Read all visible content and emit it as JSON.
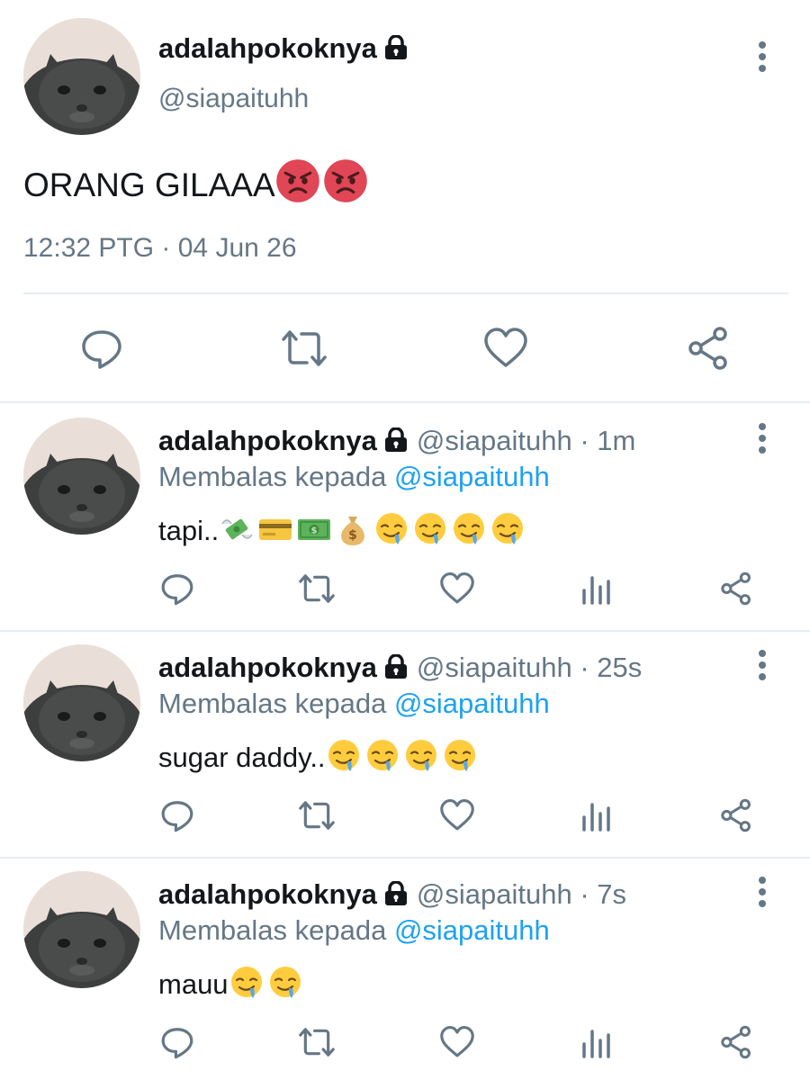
{
  "main_tweet": {
    "display_name": "adalahpokoknya",
    "handle": "@siapaituhh",
    "text": "ORANG GILAAA",
    "text_emojis": [
      "angry-face",
      "angry-face"
    ],
    "timestamp": "12:32 PTG · 04 Jun 26",
    "actions": [
      "reply",
      "retweet",
      "like",
      "share"
    ]
  },
  "replies": [
    {
      "display_name": "adalahpokoknya",
      "handle": "@siapaituhh",
      "time": "· 1m",
      "reply_prefix": "Membalas kepada ",
      "reply_mention": "@siapaituhh",
      "text": "tapi..",
      "text_emojis": [
        "money-with-wings",
        "credit-card",
        "dollar-banknote",
        "money-bag",
        "drooling-face",
        "drooling-face",
        "drooling-face",
        "drooling-face"
      ]
    },
    {
      "display_name": "adalahpokoknya",
      "handle": "@siapaituhh",
      "time": "· 25s",
      "reply_prefix": "Membalas kepada ",
      "reply_mention": "@siapaituhh",
      "text": "sugar daddy..",
      "text_emojis": [
        "drooling-face",
        "drooling-face",
        "drooling-face",
        "drooling-face"
      ]
    },
    {
      "display_name": "adalahpokoknya",
      "handle": "@siapaituhh",
      "time": "· 7s",
      "reply_prefix": "Membalas kepada ",
      "reply_mention": "@siapaituhh",
      "text": "mauu",
      "text_emojis": [
        "drooling-face",
        "drooling-face"
      ]
    }
  ],
  "colors": {
    "text_primary": "#14171a",
    "text_secondary": "#657786",
    "mention": "#1da1f2",
    "icon": "#657786",
    "divider": "#e6ecf0"
  }
}
